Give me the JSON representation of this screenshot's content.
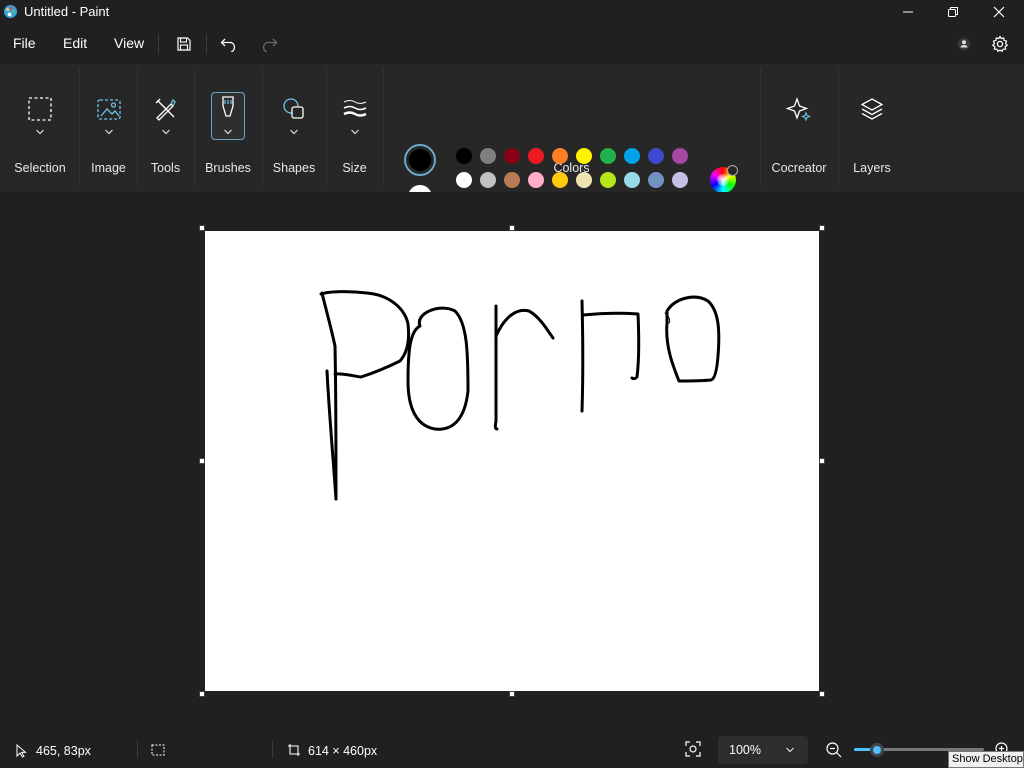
{
  "window": {
    "title": "Untitled - Paint"
  },
  "menu": {
    "file": "File",
    "edit": "Edit",
    "view": "View"
  },
  "ribbon": {
    "selection": "Selection",
    "image": "Image",
    "tools": "Tools",
    "brushes": "Brushes",
    "shapes": "Shapes",
    "size": "Size",
    "colors": "Colors",
    "cocreator": "Cocreator",
    "layers": "Layers"
  },
  "colors": {
    "primary": "#000000",
    "secondary": "#ffffff",
    "palette_row1": [
      "#000000",
      "#7f7f7f",
      "#880015",
      "#ed1c24",
      "#ff7f27",
      "#fff200",
      "#22b14c",
      "#00a2e8",
      "#3f48cc",
      "#a349a4"
    ],
    "palette_row2": [
      "#ffffff",
      "#c3c3c3",
      "#b97a57",
      "#ffaec9",
      "#ffc90e",
      "#efe4b0",
      "#b5e61d",
      "#99d9ea",
      "#7092be",
      "#c8bfe7"
    ],
    "palette_row3_count": 10,
    "accent": "#4cc2ff"
  },
  "status": {
    "cursor_position": "465, 83px",
    "canvas_size": "614 × 460px",
    "zoom": "100%",
    "zoom_level": 0.18
  },
  "tooltip": {
    "text": "Show Desktop"
  },
  "icons": {
    "app": "paint-palette-icon",
    "minimize": "minimize-icon",
    "maximize": "restore-icon",
    "close": "close-icon",
    "save": "save-icon",
    "undo": "undo-icon",
    "redo": "redo-icon",
    "account": "account-icon",
    "settings": "gear-icon"
  }
}
